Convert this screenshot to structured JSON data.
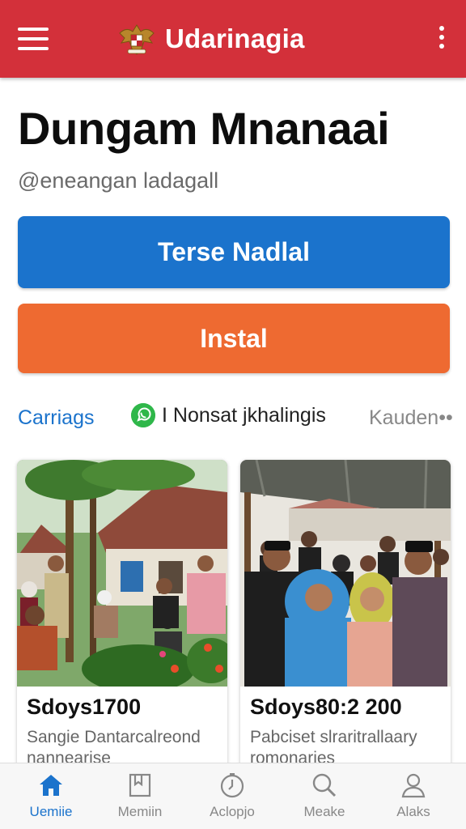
{
  "appbar": {
    "title": "Udarinagia",
    "menu_icon": "hamburger-menu-icon",
    "emblem_icon": "garuda-emblem-icon",
    "more_icon": "more-vertical-icon",
    "bar_color": "#d3303a"
  },
  "profile": {
    "name": "Dungam Mnanaai",
    "handle": "@eneangan ladagall"
  },
  "actions": {
    "primary_label": "Terse Nadlal",
    "primary_color": "#1b73cc",
    "install_label": "Instal",
    "install_color": "#ee6a31"
  },
  "tabs": [
    {
      "label": "Carriags",
      "active": true
    },
    {
      "label": "I Nonsat jkhalingis",
      "icon": "whatsapp-icon"
    },
    {
      "label": "Kauden••"
    }
  ],
  "cards": [
    {
      "title": "Sdoys1700",
      "description": "Sangie Dantarcalreond nannearise"
    },
    {
      "title": "Sdoys80:2 200",
      "description": "Pabciset slraritrallaary romonaries"
    }
  ],
  "bottom_nav": [
    {
      "label": "Uemiie",
      "icon": "home-icon",
      "active": true
    },
    {
      "label": "Memiin",
      "icon": "bookmark-icon"
    },
    {
      "label": "Aclopjo",
      "icon": "clock-icon"
    },
    {
      "label": "Meake",
      "icon": "search-icon"
    },
    {
      "label": "Alaks",
      "icon": "profile-icon"
    }
  ]
}
